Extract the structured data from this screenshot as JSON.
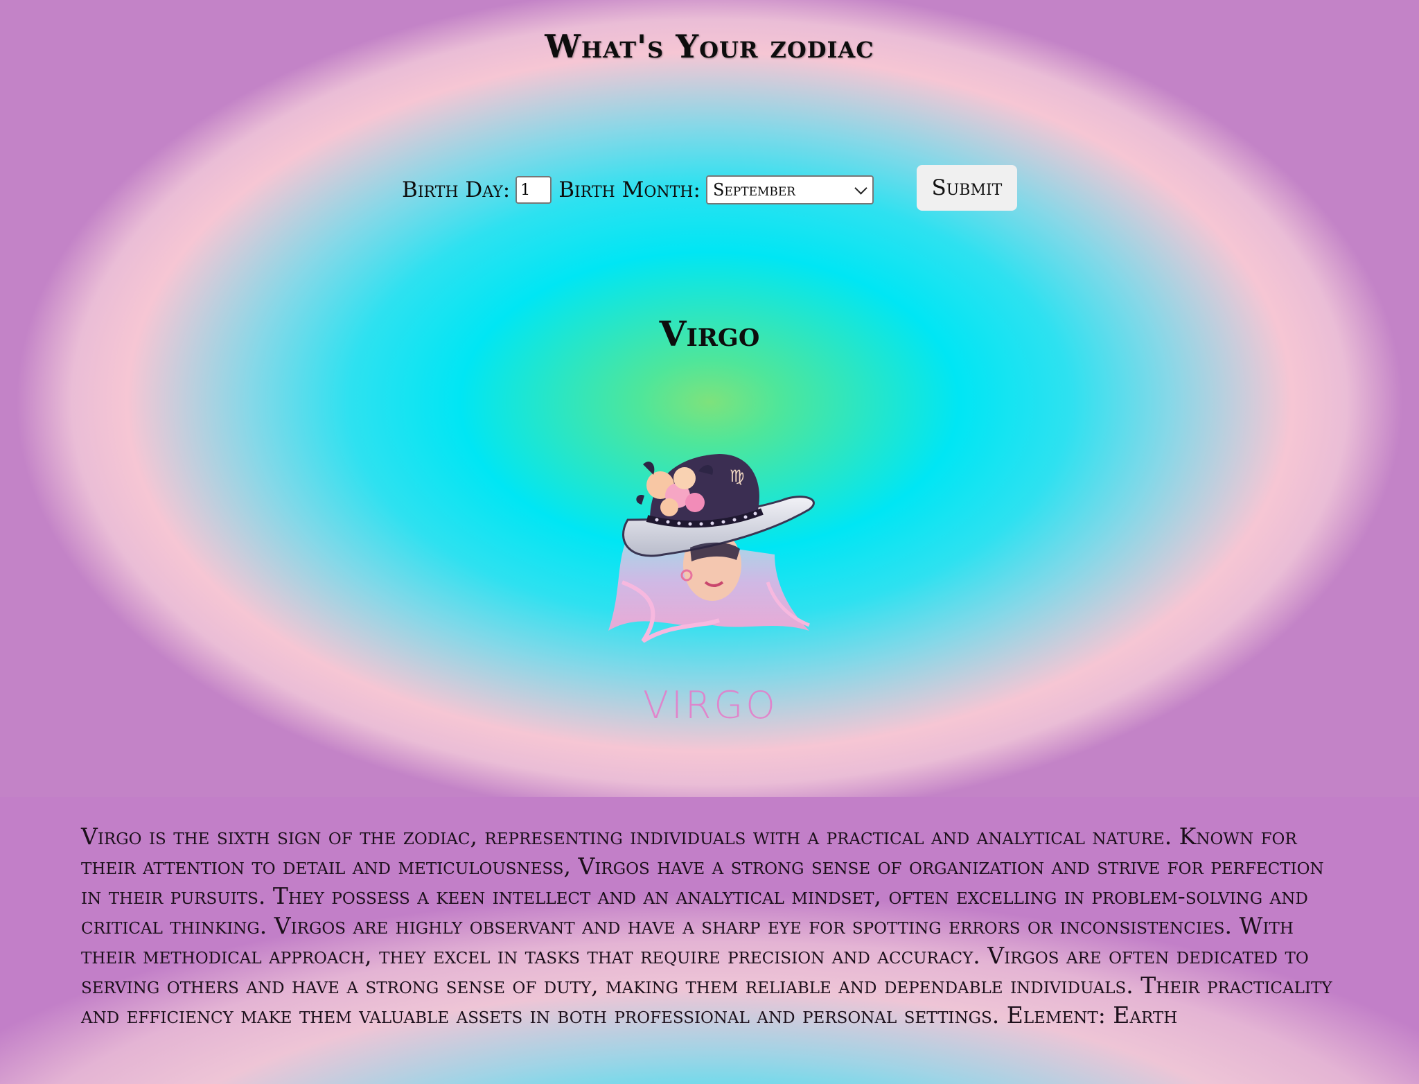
{
  "page": {
    "title": "What's Your zodiac"
  },
  "form": {
    "day_label": "Birth Day:",
    "day_value": "1",
    "month_label": "Birth Month:",
    "month_selected": "September",
    "submit_label": "Submit"
  },
  "result": {
    "sign": "Virgo",
    "image_caption": "VIRGO",
    "description": "Virgo is the sixth sign of the zodiac, representing individuals with a practical and analytical nature. Known for their attention to detail and meticulousness, Virgos have a strong sense of organization and strive for perfection in their pursuits. They possess a keen intellect and an analytical mindset, often excelling in problem-solving and critical thinking. Virgos are highly observant and have a sharp eye for spotting errors or inconsistencies. With their methodical approach, they excel in tasks that require precision and accuracy. Virgos are often dedicated to serving others and have a strong sense of duty, making them reliable and dependable individuals. Their practicality and efficiency make them valuable assets in both professional and personal settings. Element: Earth"
  },
  "colors": {
    "center": "#7ee27c",
    "cyan": "#00e6f4",
    "pink": "#f6c6d4",
    "purple": "#c07ec6",
    "button": "#f0f0f0"
  },
  "icons": {
    "month_dropdown": "chevron-down-icon",
    "illustration": "virgo-woman-in-hat"
  }
}
